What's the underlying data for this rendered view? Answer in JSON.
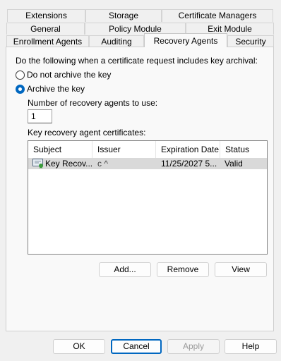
{
  "tabs": {
    "row1": [
      "Extensions",
      "Storage",
      "Certificate Managers"
    ],
    "row2": [
      "General",
      "Policy Module",
      "Exit Module"
    ],
    "row3": [
      "Enrollment Agents",
      "Auditing",
      "Recovery Agents",
      "Security"
    ],
    "active": "Recovery Agents"
  },
  "archival": {
    "prompt": "Do the following when a certificate request includes key archival:",
    "option_no": "Do not archive the key",
    "option_yes": "Archive the key",
    "selected": "Archive the key",
    "agents_label": "Number of recovery agents to use:",
    "agents_value": "1",
    "certs_label": "Key recovery agent certificates:"
  },
  "certificates": {
    "columns": [
      "Subject",
      "Issuer",
      "Expiration Date",
      "Status"
    ],
    "rows": [
      {
        "subject": "Key Recov...",
        "issuer": "c   ^",
        "expiration": "11/25/2027 5...",
        "status": "Valid",
        "icon": "certificate-icon"
      }
    ]
  },
  "list_actions": {
    "add": "Add...",
    "remove": "Remove",
    "view": "View"
  },
  "dialog_buttons": {
    "ok": "OK",
    "cancel": "Cancel",
    "apply": "Apply",
    "help": "Help"
  },
  "colors": {
    "accent": "#0067c0",
    "selected_row": "#d9d9d9",
    "disabled_text": "#9a9a9a"
  }
}
